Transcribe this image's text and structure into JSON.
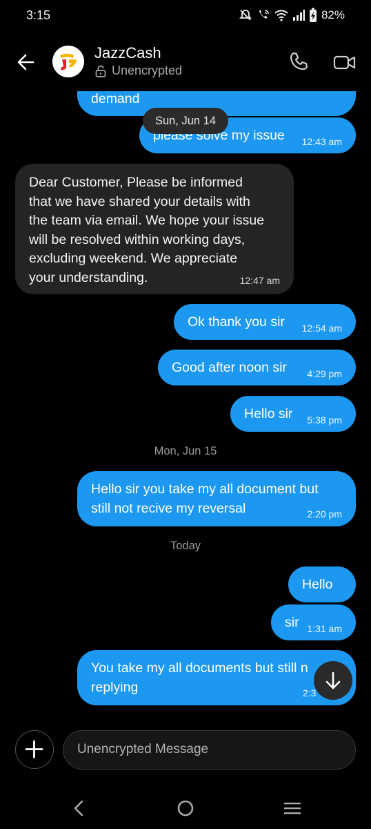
{
  "status_bar": {
    "time": "3:15",
    "battery": "82%"
  },
  "header": {
    "contact_name": "JazzCash",
    "encryption_status": "Unencrypted",
    "back_icon": "arrow-left-icon",
    "call_icon": "phone-icon",
    "video_icon": "video-camera-icon"
  },
  "thread": {
    "partial_top": {
      "text": "demand"
    },
    "date_pill": "Sun, Jun 14",
    "messages": [
      {
        "text": "please solve my issue",
        "time": "12:43 am",
        "dir": "out"
      },
      {
        "lines": [
          "Dear Customer, Please be informed",
          "that we have shared your details with",
          "the team via email. We hope your issue",
          "will be resolved within working days,",
          "excluding weekend. We appreciate",
          "your understanding."
        ],
        "time": "12:47 am",
        "dir": "in"
      },
      {
        "text": "Ok thank you sir",
        "time": "12:54 am",
        "dir": "out"
      },
      {
        "text": "Good after noon sir",
        "time": "4:29 pm",
        "dir": "out"
      },
      {
        "text": "Hello sir",
        "time": "5:38 pm",
        "dir": "out"
      }
    ],
    "date_mon": "Mon, Jun 15",
    "messages_mon": [
      {
        "lines": [
          "Hello sir you take my all document but",
          "still not recive my reversal"
        ],
        "time": "2:20 pm",
        "dir": "out"
      }
    ],
    "date_today": "Today",
    "messages_today": [
      {
        "text": "Hello",
        "dir": "out"
      },
      {
        "text": "sir",
        "time": "1:31 am",
        "dir": "out"
      },
      {
        "lines": [
          "You take my all documents but still n",
          "replying"
        ],
        "time": "2:3",
        "dir": "out"
      }
    ],
    "scroll_icon": "arrow-down-icon"
  },
  "composer": {
    "add_icon": "plus-icon",
    "placeholder": "Unencrypted Message"
  },
  "navigation": {
    "back_icon": "nav-back-icon",
    "home_icon": "nav-home-icon",
    "recents_icon": "nav-menu-icon"
  },
  "colors": {
    "outgoing_bubble": "#1d98f0",
    "incoming_bubble": "#242424",
    "background": "#000000"
  }
}
